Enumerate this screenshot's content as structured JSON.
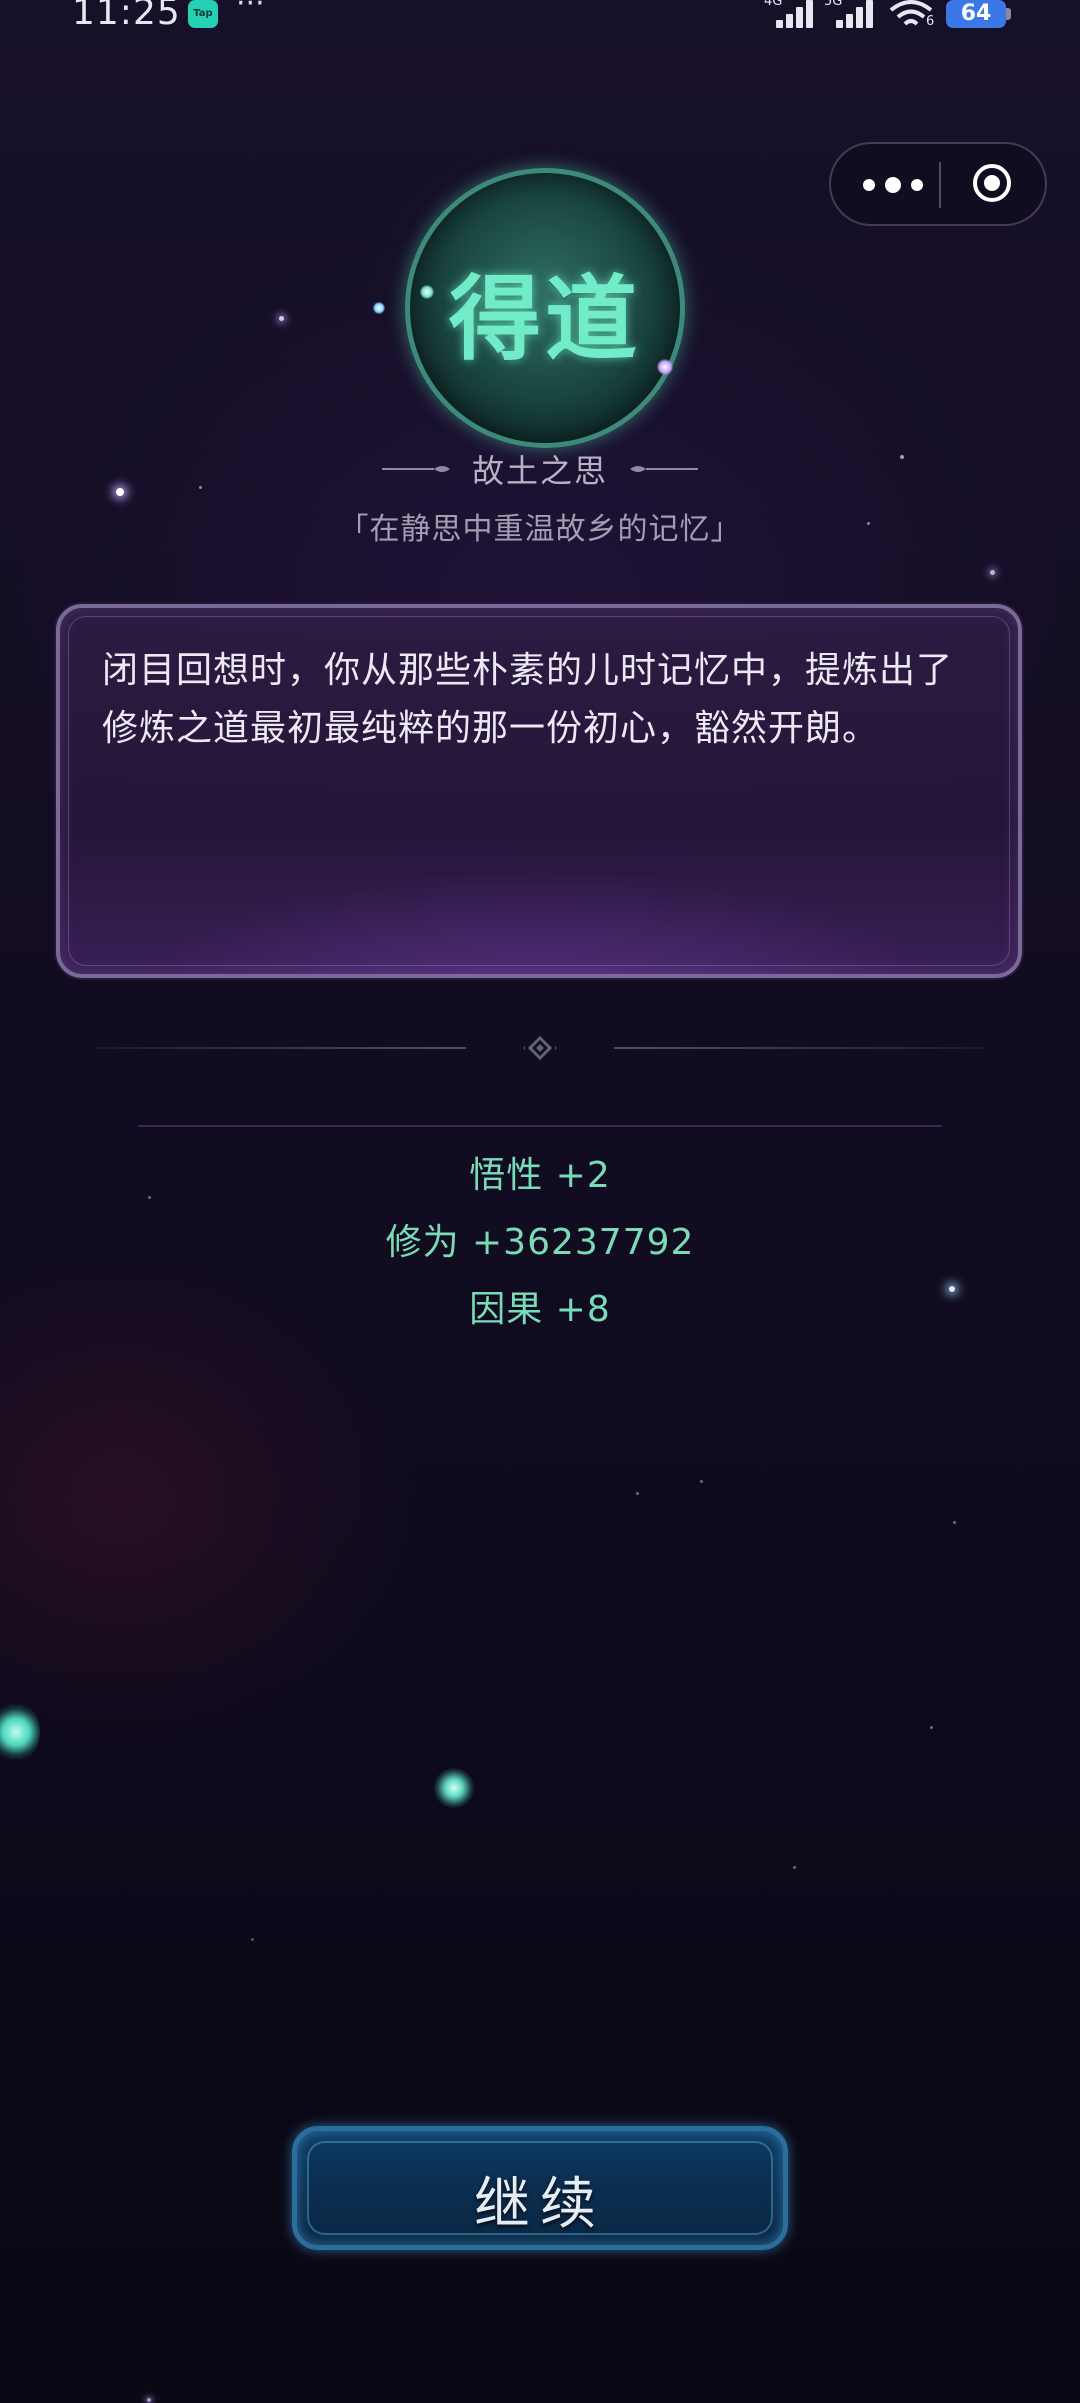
{
  "status_bar": {
    "time": "11:25",
    "app_badge": "Tap",
    "more": "···",
    "signal_1": "4G",
    "signal_2": "5G",
    "wifi_sub": "6",
    "battery": "64"
  },
  "capsule": {
    "more_icon": "more-dots-icon",
    "close_icon": "target-icon"
  },
  "event": {
    "emblem": "得道",
    "title": "故土之思",
    "subtitle": "「在静思中重温故乡的记忆」",
    "description": "闭目回想时，你从那些朴素的儿时记忆中，提炼出了修炼之道最初最纯粹的那一份初心，豁然开朗。"
  },
  "rewards": [
    {
      "label": "悟性 +2"
    },
    {
      "label": "修为 +36237792"
    },
    {
      "label": "因果 +8"
    }
  ],
  "actions": {
    "continue_label": "继续"
  },
  "colors": {
    "reward_text": "#79dcb6",
    "emblem_text": "#72ecc8",
    "button_border": "#2c6e9a"
  }
}
